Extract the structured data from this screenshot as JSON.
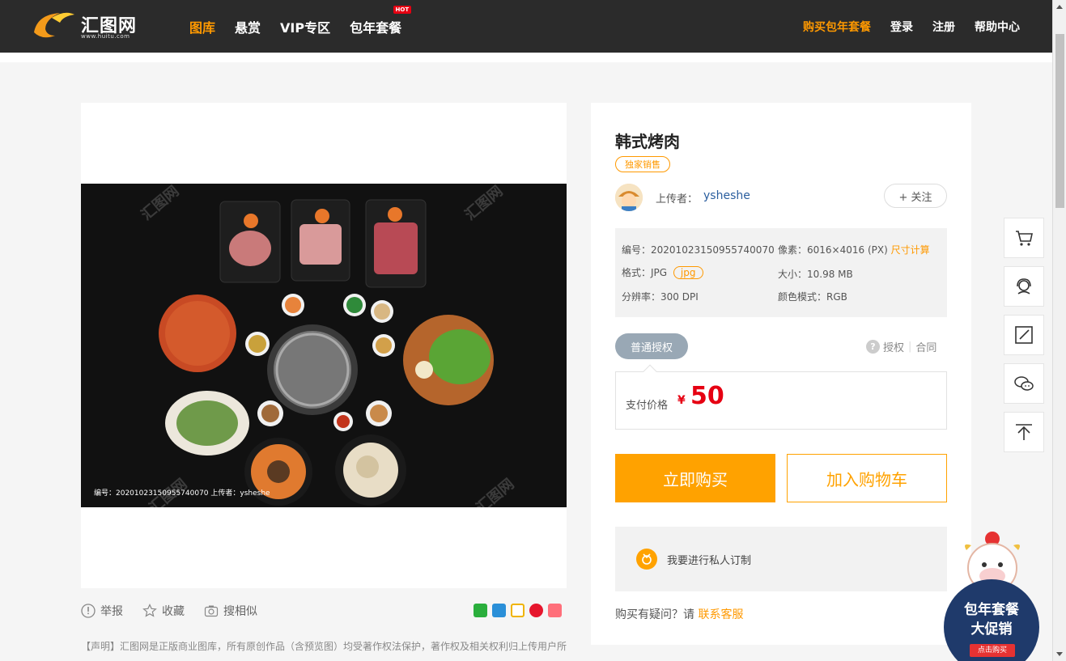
{
  "header": {
    "logo_text": "汇图网",
    "logo_sub": "www.huitu.com",
    "nav": [
      "图库",
      "悬赏",
      "VIP专区",
      "包年套餐"
    ],
    "hot_badge": "HOT",
    "right_nav": [
      "购买包年套餐",
      "登录",
      "注册",
      "帮助中心"
    ],
    "accent_color": "#ff9900"
  },
  "image": {
    "caption": "编号：20201023150955740070  上传者：ysheshe",
    "watermark": "汇图网"
  },
  "actions": {
    "report": "举报",
    "favorite": "收藏",
    "similar": "搜相似"
  },
  "notice": "【声明】汇图网是正版商业图库，所有原创作品（含预览图）均受著作权法保护，著作权及相关权利归上传用户所",
  "product": {
    "title": "韩式烤肉",
    "exclusive": "独家销售",
    "uploader_label": "上传者：",
    "uploader_name": "ysheshe",
    "follow": "+ 关注",
    "meta": {
      "id_label": "编号：",
      "id": "20201023150955740070",
      "pixels_label": "像素：",
      "pixels": "6016×4016 (PX)",
      "size_calc": "尺寸计算",
      "format_label": "格式：",
      "format": "JPG",
      "format_tag": "jpg",
      "filesize_label": "大小：",
      "filesize": "10.98 MB",
      "dpi_label": "分辨率：",
      "dpi": "300 DPI",
      "color_label": "颜色模式：",
      "color": "RGB"
    },
    "license_tab": "普通授权",
    "license_link": "授权",
    "contract_link": "合同",
    "price_label": "支付价格",
    "currency": "¥",
    "price": "50",
    "buy_now": "立即购买",
    "add_cart": "加入购物车",
    "custom_order": "我要进行私人订制",
    "question_prefix": "购买有疑问？请",
    "question_link": "联系客服"
  },
  "promo": {
    "line1": "包年套餐",
    "line2": "大促销",
    "button": "点击购买"
  }
}
